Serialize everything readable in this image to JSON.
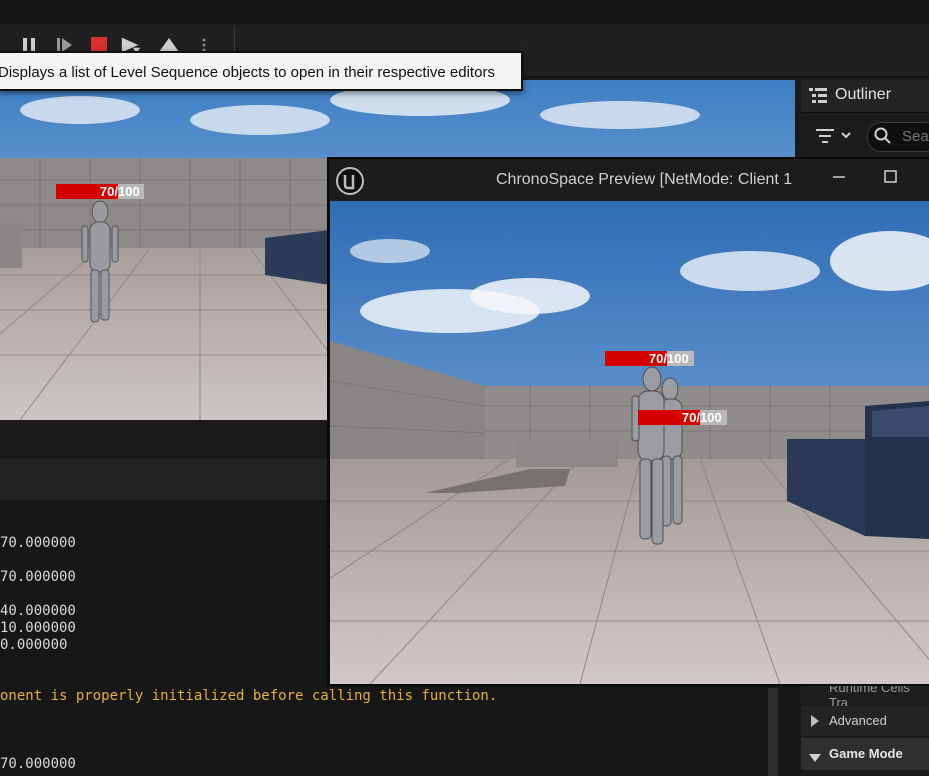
{
  "toolbar": {
    "buttons": [
      {
        "name": "pause-icon"
      },
      {
        "name": "step-frame-icon"
      },
      {
        "name": "stop-icon",
        "color": "#d93030"
      },
      {
        "name": "eject-icon"
      },
      {
        "name": "simulate-icon"
      },
      {
        "name": "more-options-icon"
      }
    ]
  },
  "tooltip": {
    "text": "Displays a list of Level Sequence objects to open in their respective editors"
  },
  "viewport": {
    "health_current": "70/",
    "health_max": "100"
  },
  "preview": {
    "title": "ChronoSpace Preview [NetMode: Client 1",
    "health_bars": [
      {
        "current": "70/",
        "max": "100"
      },
      {
        "current": "70/",
        "max": "100"
      }
    ]
  },
  "outliner": {
    "title": "Outliner",
    "search_placeholder": "Search",
    "rows": [
      {
        "label": "Runtime Cells Tra"
      },
      {
        "label": "Advanced"
      },
      {
        "label": "Game Mode"
      }
    ]
  },
  "log": {
    "lines": [
      "70.000000",
      "70.000000",
      "40.000000",
      "10.000000",
      "0.000000",
      "onent is properly initialized before calling this function.",
      "70.000000"
    ]
  },
  "colors": {
    "health_red": "#d50000",
    "health_grey": "#b8b8b8",
    "warning_text": "#e6b23a"
  }
}
